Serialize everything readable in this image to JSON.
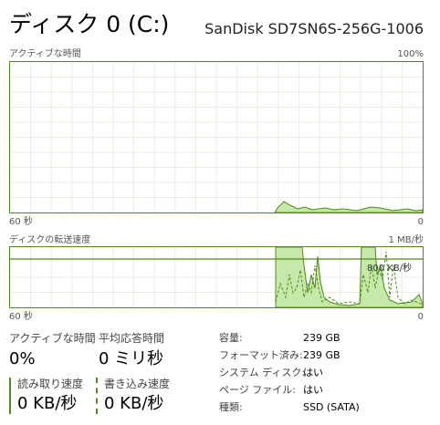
{
  "header": {
    "title": "ディスク 0 (C:)",
    "model": "SanDisk SD7SN6S-256G-1006"
  },
  "active_time_graph": {
    "label": "アクティブな時間",
    "max_label": "100%",
    "time_label": "60 秒",
    "min_label": "0"
  },
  "transfer_graph": {
    "label": "ディスクの転送速度",
    "max_label": "1 MB/秒",
    "ref_label": "800 KB/秒",
    "time_label": "60 秒",
    "min_label": "0"
  },
  "stats": {
    "active_time": {
      "label": "アクティブな時間",
      "value": "0%"
    },
    "avg_response": {
      "label": "平均応答時間",
      "value": "0 ミリ秒"
    },
    "read_speed": {
      "label": "読み取り速度",
      "value": "0 KB/秒"
    },
    "write_speed": {
      "label": "書き込み速度",
      "value": "0 KB/秒"
    }
  },
  "details": [
    {
      "label": "容量:",
      "value": "239 GB"
    },
    {
      "label": "フォーマット済み:",
      "value": "239 GB"
    },
    {
      "label": "システム ディスク:",
      "value": "はい"
    },
    {
      "label": "ページ ファイル:",
      "value": "はい"
    },
    {
      "label": "種類:",
      "value": "SSD (SATA)"
    }
  ],
  "colors": {
    "accent": "#4d8b1a",
    "fill": "#c6e8a8",
    "grid": "#e8efe2"
  }
}
